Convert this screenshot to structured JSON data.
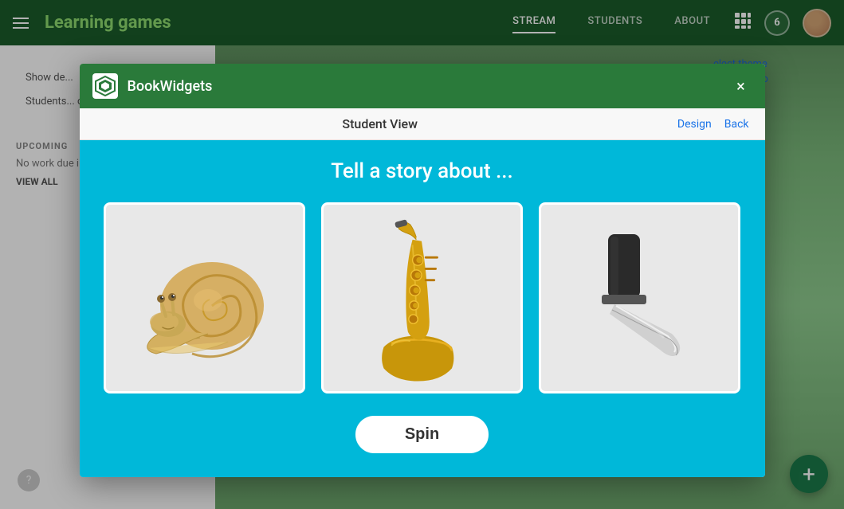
{
  "app": {
    "title": "Learning games",
    "background_color": "#1a5c2a"
  },
  "nav": {
    "links": [
      {
        "label": "STREAM",
        "active": true
      },
      {
        "label": "STUDENTS",
        "active": false
      },
      {
        "label": "ABOUT",
        "active": false
      }
    ],
    "badge_count": "6"
  },
  "background": {
    "show_description": "Show de...",
    "students_comment": "Students... commen...",
    "upcoming_label": "UPCOMING",
    "no_work": "No work due in soon...",
    "view_all": "VIEW ALL",
    "select_theme": "elect theme",
    "upload_photo": "pload photo"
  },
  "modal": {
    "brand": "BookWidgets",
    "close_label": "×",
    "toolbar": {
      "title": "Student View",
      "design_link": "Design",
      "back_link": "Back"
    },
    "story_title": "Tell a story about ...",
    "cards": [
      {
        "name": "snail",
        "emoji": "🐌"
      },
      {
        "name": "saxophone",
        "emoji": "🎷"
      },
      {
        "name": "knife",
        "emoji": "🔪"
      }
    ],
    "spin_button_label": "Spin"
  }
}
